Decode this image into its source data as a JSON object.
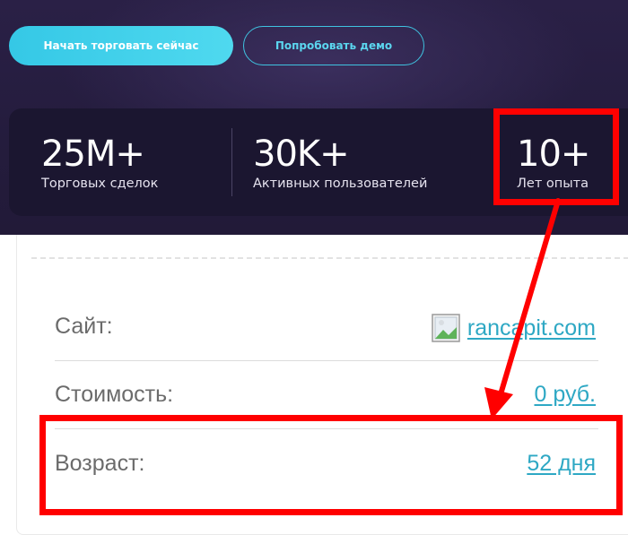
{
  "hero": {
    "cta_primary": "Начать торговать сейчас",
    "cta_demo": "Попробовать демо",
    "stats": [
      {
        "value": "25M+",
        "label": "Торговых сделок"
      },
      {
        "value": "30K+",
        "label": "Активных пользователей"
      },
      {
        "value": "10+",
        "label": "Лет опыта"
      }
    ]
  },
  "info": {
    "rows": [
      {
        "label": "Сайт:",
        "value": "rancapit.com",
        "icon": "broken-image-icon"
      },
      {
        "label": "Стоимость:",
        "value": "0 руб."
      },
      {
        "label": "Возраст:",
        "value": "52 дня"
      }
    ]
  },
  "colors": {
    "hero_bg": "#241c3d",
    "accent_cyan": "#35c8e6",
    "link": "#2ea8c4",
    "annotation_red": "#ff0000"
  }
}
